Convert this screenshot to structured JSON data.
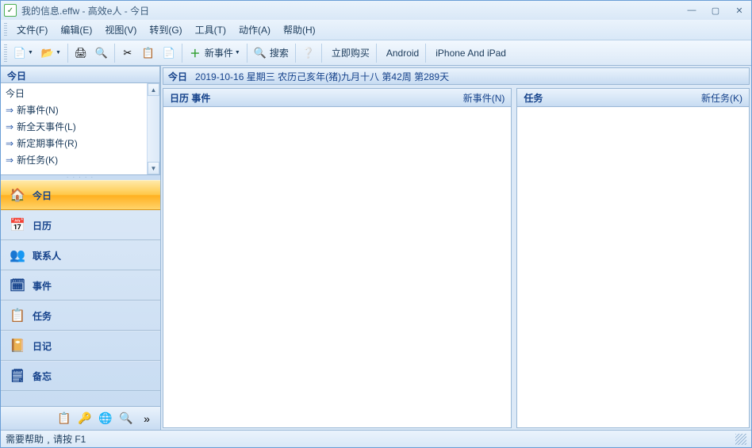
{
  "title": "我的信息.effw - 高效e人 - 今日",
  "menu": {
    "file": "文件(F)",
    "edit": "编辑(E)",
    "view": "视图(V)",
    "goto": "转到(G)",
    "tools": "工具(T)",
    "actions": "动作(A)",
    "help": "帮助(H)"
  },
  "toolbar": {
    "new_event": "新事件",
    "search": "搜索",
    "buy_now": "立即购买",
    "android": "Android",
    "iphone": "iPhone And iPad"
  },
  "sidebar": {
    "header": "今日",
    "tree_root": "今日",
    "tree": {
      "new_event": "新事件(N)",
      "new_allday": "新全天事件(L)",
      "new_recurring": "新定期事件(R)",
      "new_task": "新任务(K)"
    },
    "nav": {
      "today": "今日",
      "calendar": "日历",
      "contacts": "联系人",
      "events": "事件",
      "tasks": "任务",
      "diary": "日记",
      "notes": "备忘"
    }
  },
  "main": {
    "today_label": "今日",
    "date_line": "2019-10-16 星期三 农历己亥年(猪)九月十八  第42周 第289天",
    "calendar_panel": {
      "title": "日历  事件",
      "new_link": "新事件(N)"
    },
    "tasks_panel": {
      "title": "任务",
      "new_link": "新任务(K)"
    }
  },
  "status": "需要帮助﹐请按 F1"
}
